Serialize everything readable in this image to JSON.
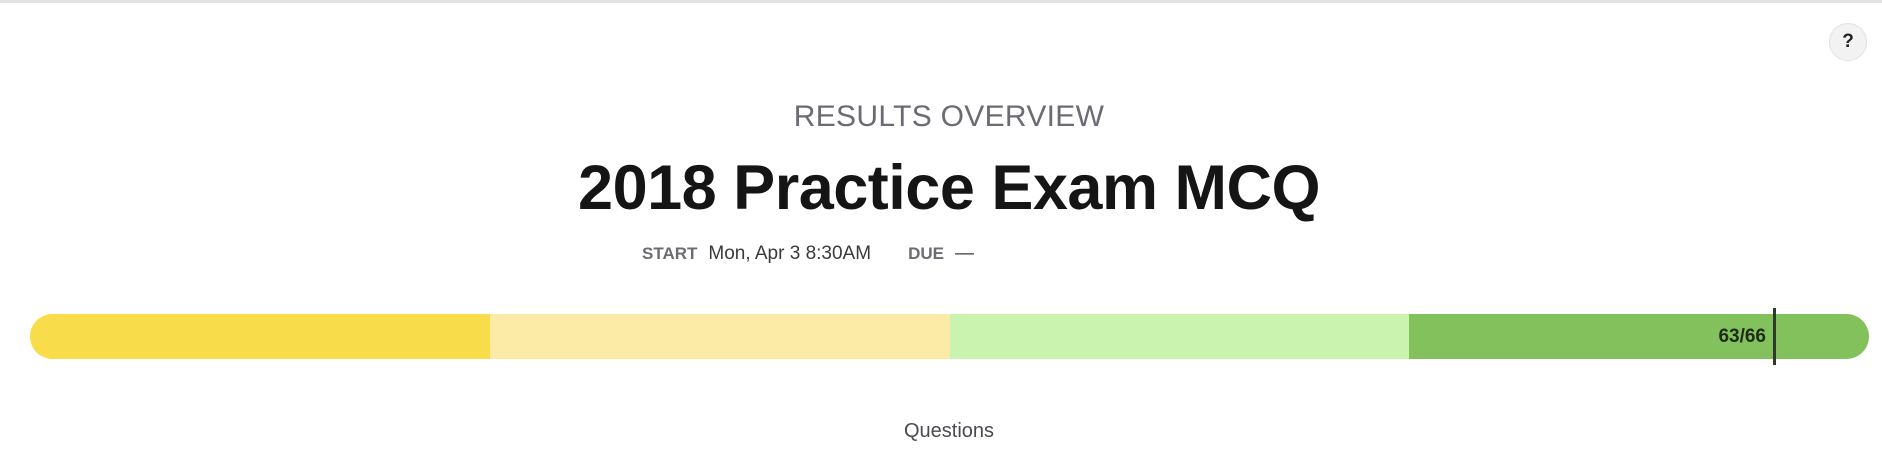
{
  "help": {
    "label": "?"
  },
  "header": {
    "eyebrow": "RESULTS OVERVIEW",
    "title": "2018 Practice Exam MCQ"
  },
  "meta": {
    "start_label": "START",
    "start_value": "Mon, Apr 3 8:30AM",
    "due_label": "DUE",
    "due_value": "—"
  },
  "progress": {
    "score_text": "63/66",
    "score": 63,
    "total": 66,
    "segments": [
      {
        "name": "band-1",
        "fraction": 0.25,
        "color": "#f8dc4a"
      },
      {
        "name": "band-2",
        "fraction": 0.25,
        "color": "#fbeba6"
      },
      {
        "name": "band-3",
        "fraction": 0.25,
        "color": "#caf3b0"
      },
      {
        "name": "band-4",
        "fraction": 0.25,
        "color": "#82c15c"
      }
    ]
  },
  "footer": {
    "label": "Questions"
  }
}
